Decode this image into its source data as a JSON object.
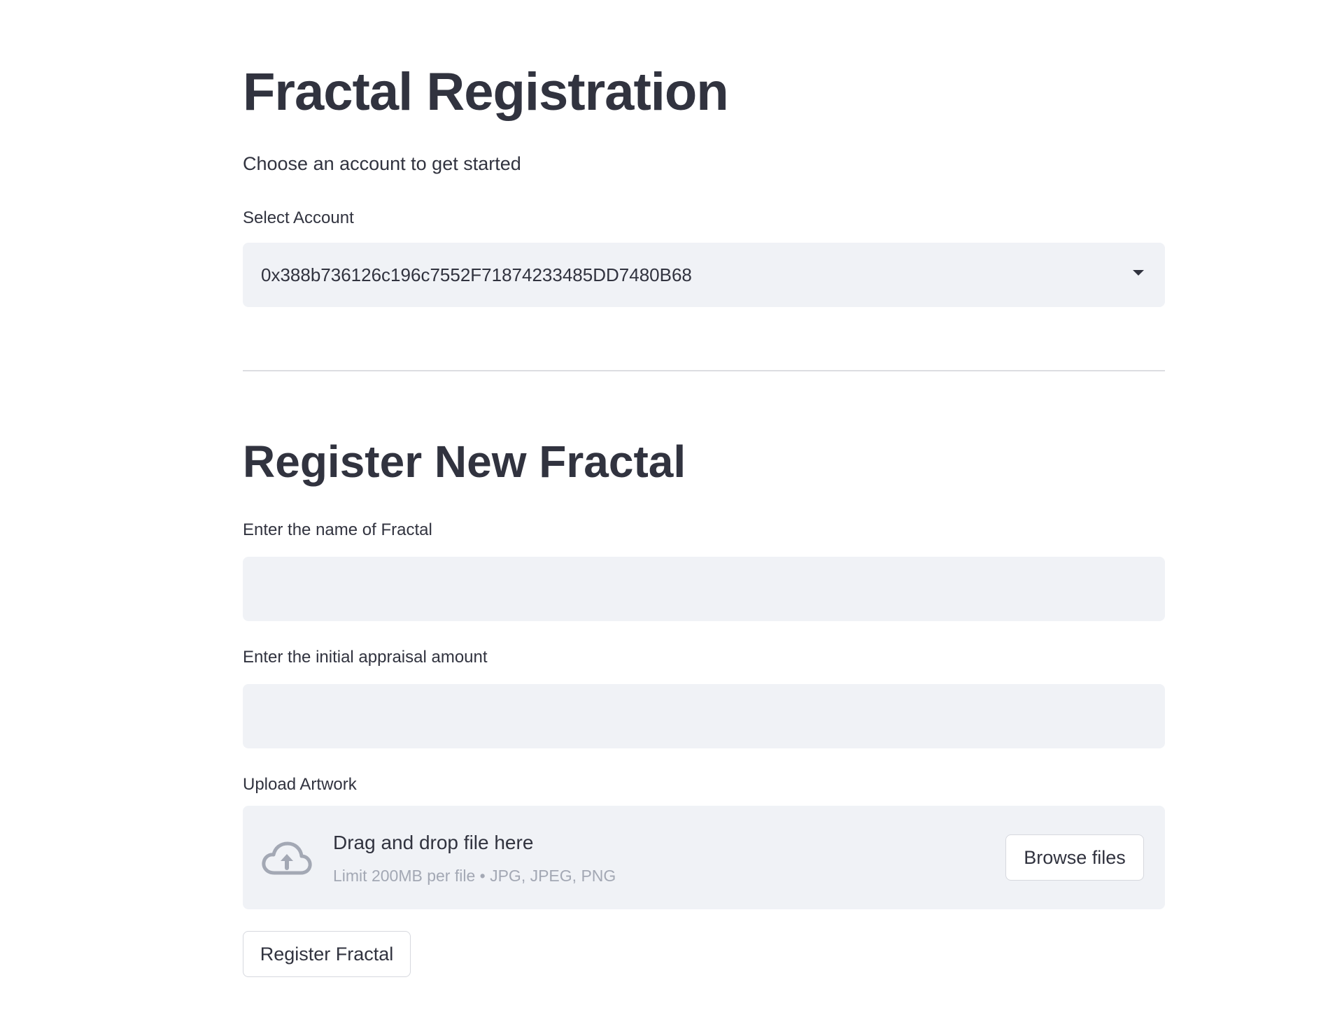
{
  "header": {
    "title": "Fractal Registration",
    "subtitle": "Choose an account to get started"
  },
  "account": {
    "label": "Select Account",
    "selected": "0x388b736126c196c7552F71874233485DD7480B68"
  },
  "register": {
    "title": "Register New Fractal",
    "name_label": "Enter the name of Fractal",
    "name_value": "",
    "appraisal_label": "Enter the initial appraisal amount",
    "appraisal_value": "",
    "upload_label": "Upload Artwork",
    "drop_text": "Drag and drop file here",
    "limit_text": "Limit 200MB per file • JPG, JPEG, PNG",
    "browse_label": "Browse files",
    "submit_label": "Register Fractal"
  },
  "icons": {
    "upload": "cloud-upload-icon",
    "dropdown": "chevron-down-icon"
  },
  "colors": {
    "text": "#31333f",
    "input_bg": "#f0f2f6",
    "muted": "#a3a8b4",
    "icon": "#a3a8b4"
  }
}
